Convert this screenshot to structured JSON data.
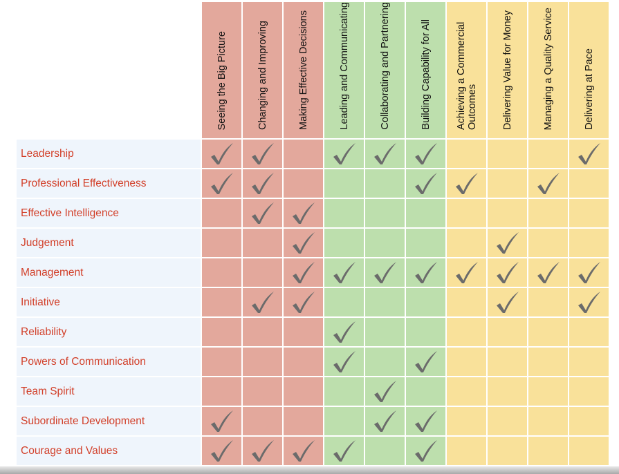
{
  "colors": {
    "red": "#e3a89c",
    "green": "#bddfad",
    "yellow": "#f9e19a",
    "label_bg": "#eff5fc",
    "label_text": "#d2402a",
    "check": "#6b6b6b"
  },
  "columns": [
    {
      "label": "Seeing the Big Picture",
      "group": "red"
    },
    {
      "label": "Changing and Improving",
      "group": "red"
    },
    {
      "label": "Making Effective Decisions",
      "group": "red"
    },
    {
      "label": "Leading and Communicating",
      "group": "green"
    },
    {
      "label": "Collaborating and Partnering",
      "group": "green"
    },
    {
      "label": "Building Capability for All",
      "group": "green"
    },
    {
      "label": "Achieving a Commercial Outcomes",
      "group": "yellow"
    },
    {
      "label": "Delivering Value for Money",
      "group": "yellow"
    },
    {
      "label": "Managing a Quality Service",
      "group": "yellow"
    },
    {
      "label": "Delivering at Pace",
      "group": "yellow"
    }
  ],
  "rows": [
    {
      "label": "Leadership",
      "checks": [
        1,
        1,
        0,
        1,
        1,
        1,
        0,
        0,
        0,
        1
      ]
    },
    {
      "label": "Professional Effectiveness",
      "checks": [
        1,
        1,
        0,
        0,
        0,
        1,
        1,
        0,
        1,
        0
      ]
    },
    {
      "label": "Effective Intelligence",
      "checks": [
        0,
        1,
        1,
        0,
        0,
        0,
        0,
        0,
        0,
        0
      ]
    },
    {
      "label": "Judgement",
      "checks": [
        0,
        0,
        1,
        0,
        0,
        0,
        0,
        1,
        0,
        0
      ]
    },
    {
      "label": "Management",
      "checks": [
        0,
        0,
        1,
        1,
        1,
        1,
        1,
        1,
        1,
        1
      ]
    },
    {
      "label": "Initiative",
      "checks": [
        0,
        1,
        1,
        0,
        0,
        0,
        0,
        1,
        0,
        1
      ]
    },
    {
      "label": "Reliability",
      "checks": [
        0,
        0,
        0,
        1,
        0,
        0,
        0,
        0,
        0,
        0
      ]
    },
    {
      "label": "Powers of Communication",
      "checks": [
        0,
        0,
        0,
        1,
        0,
        1,
        0,
        0,
        0,
        0
      ]
    },
    {
      "label": "Team Spirit",
      "checks": [
        0,
        0,
        0,
        0,
        1,
        0,
        0,
        0,
        0,
        0
      ]
    },
    {
      "label": "Subordinate Development",
      "checks": [
        1,
        0,
        0,
        0,
        1,
        1,
        0,
        0,
        0,
        0
      ]
    },
    {
      "label": "Courage and Values",
      "checks": [
        1,
        1,
        1,
        1,
        0,
        1,
        0,
        0,
        0,
        0
      ]
    }
  ]
}
